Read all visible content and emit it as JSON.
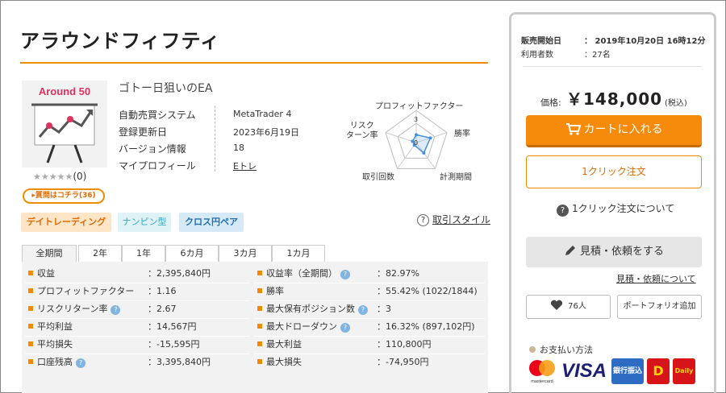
{
  "product": {
    "title": "アラウンドフィフティ",
    "thumbnail_text": "Around 50",
    "subtitle": "ゴトー日狙いのEA",
    "rating": "★★★★★",
    "rating_count": "(0)",
    "question_button": "質問はコチラ(36)"
  },
  "info": {
    "rows": [
      {
        "label": "自動売買システム",
        "value": "MetaTrader 4"
      },
      {
        "label": "登録更新日",
        "value": "2023年6月19日"
      },
      {
        "label": "バージョン情報",
        "value": "18"
      },
      {
        "label": "マイプロフィール",
        "value": "Eトレ"
      }
    ]
  },
  "radar": {
    "labels": {
      "top": "プロフィットファクター",
      "left_line1": "リスク",
      "left_line2": "ターン率",
      "right": "勝率",
      "bottom_left": "取引回数",
      "bottom_right": "計測期間"
    },
    "scale_outer": "3",
    "scale_inner": "0"
  },
  "chart_data": {
    "type": "radar",
    "axes": [
      "プロフィットファクター",
      "勝率",
      "計測期間",
      "取引回数",
      "リスクリターン率"
    ],
    "values": [
      1.2,
      2.3,
      2.0,
      0.5,
      0.6
    ],
    "rlim": [
      0,
      5
    ]
  },
  "tags": {
    "day_trade": "デイトレーディング",
    "nanpin": "ナンピン型",
    "cross": "クロス円ペア"
  },
  "trade_style": {
    "icon": "?",
    "label": "取引スタイル"
  },
  "tabs": [
    "全期間",
    "2年",
    "1年",
    "6カ月",
    "3カ月",
    "1カ月"
  ],
  "stats": {
    "left": [
      {
        "label": "収益",
        "value": "：2,395,840円",
        "help": false
      },
      {
        "label": "プロフィットファクター",
        "value": "：1.16",
        "help": false
      },
      {
        "label": "リスクリターン率",
        "value": "：2.67",
        "help": true
      },
      {
        "label": "平均利益",
        "value": "：14,567円",
        "help": false
      },
      {
        "label": "平均損失",
        "value": "：-15,595円",
        "help": false
      },
      {
        "label": "口座残高",
        "value": "：3,395,840円",
        "help": true
      }
    ],
    "right": [
      {
        "label": "収益率（全期間）",
        "value": "：82.97%",
        "help": true
      },
      {
        "label": "勝率",
        "value": "：55.42% (1022/1844)",
        "help": false
      },
      {
        "label": "最大保有ポジション数",
        "value": "：3",
        "help": true
      },
      {
        "label": "最大ドローダウン",
        "value": "：16.32% (897,102円)",
        "help": true
      },
      {
        "label": "最大利益",
        "value": "：110,800円",
        "help": false
      },
      {
        "label": "最大損失",
        "value": "：-74,950円",
        "help": false
      }
    ]
  },
  "sale": {
    "start_label": "販売開始日",
    "start_value": "：  2019年10月20日 16時12分",
    "users_label": "利用者数",
    "users_value": "：27名"
  },
  "purchase": {
    "price_label": "価格:",
    "price": "￥148,000",
    "tax": "(税込)",
    "cart_button": "カートに入れる",
    "oneclick_button": "1クリック注文",
    "oneclick_about": "1クリック注文について",
    "quote_button": "見積・依頼をする",
    "quote_about": "見積・依頼について",
    "fav_count": "76人",
    "portfolio_button": "ポートフォリオ追加",
    "payment_label": "お支払い方法",
    "payment_logos": {
      "mastercard": "mastercard",
      "visa": "VISA",
      "bank": "銀行振込",
      "daily1": "D",
      "daily2": "Daily"
    }
  },
  "colors": {
    "accent": "#f08c00",
    "cart": "#f58a0b",
    "stats_bg": "#f2f2f2"
  }
}
